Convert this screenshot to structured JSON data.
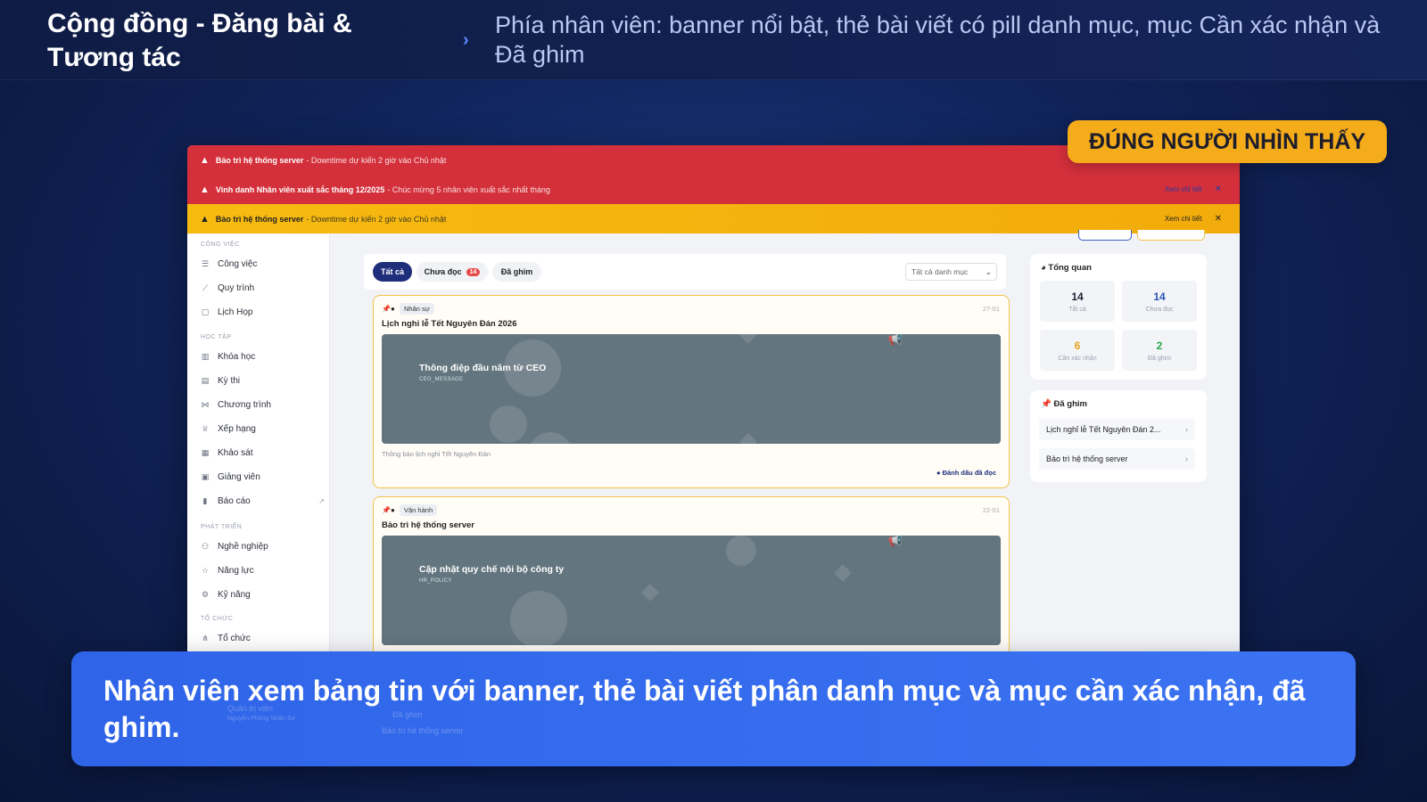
{
  "header": {
    "title": "Cộng đồng - Đăng bài & Tương tác",
    "subtitle": "Phía nhân viên: banner nổi bật, thẻ bài viết có pill danh mục, mục Cần xác nhận và Đã ghim"
  },
  "badge": "ĐÚNG NGƯỜI NHÌN THẤY",
  "banners": [
    {
      "title": "Bảo trì hệ thống server",
      "desc": "- Downtime dự kiến 2 giờ vào Chủ nhật",
      "link": "",
      "color": "#d4303b"
    },
    {
      "title": "Vinh danh Nhân viên xuất sắc tháng 12/2025",
      "desc": "- Chúc mừng 5 nhân viên xuất sắc nhất tháng",
      "link": "Xem chi tiết",
      "color": "#d4303b"
    },
    {
      "title": "Bảo trì hệ thống server",
      "desc": "- Downtime dự kiến 2 giờ vào Chủ nhật",
      "link": "Xem chi tiết",
      "color": "#f5b50f"
    }
  ],
  "sidebar": {
    "sections": [
      "CÔNG VIỆC",
      "HỌC TẬP",
      "PHÁT TRIỂN",
      "TỔ CHỨC"
    ],
    "items": [
      {
        "label": "Công việc",
        "icon": "list-icon"
      },
      {
        "label": "Quy trình",
        "icon": "flow-icon"
      },
      {
        "label": "Lịch Họp",
        "icon": "calendar-icon"
      },
      {
        "label": "Khóa học",
        "icon": "book-icon"
      },
      {
        "label": "Kỳ thi",
        "icon": "exam-icon"
      },
      {
        "label": "Chương trình",
        "icon": "program-icon"
      },
      {
        "label": "Xếp hạng",
        "icon": "trophy-icon"
      },
      {
        "label": "Khảo sát",
        "icon": "survey-icon"
      },
      {
        "label": "Giảng viên",
        "icon": "teacher-icon"
      },
      {
        "label": "Báo cáo",
        "icon": "chart-icon"
      },
      {
        "label": "Nghề nghiệp",
        "icon": "career-icon"
      },
      {
        "label": "Năng lực",
        "icon": "star-icon"
      },
      {
        "label": "Kỹ năng",
        "icon": "skill-icon"
      },
      {
        "label": "Tổ chức",
        "icon": "org-icon"
      }
    ]
  },
  "tabs": {
    "all": "Tất cả",
    "unread": "Chưa đọc",
    "unread_count": "14",
    "pinned": "Đã ghim",
    "category_select": "Tất cả danh mục"
  },
  "posts": [
    {
      "category": "Nhân sự",
      "date": "27-01",
      "title": "Lịch nghỉ lễ Tết Nguyên Đán 2026",
      "media_title": "Thông điệp đầu năm từ CEO",
      "media_code": "CEO_MESSAGE",
      "desc": "Thông báo lịch nghỉ Tết Nguyên Đán",
      "action": "Đánh dấu đã đọc"
    },
    {
      "category": "Vận hành",
      "date": "22-01",
      "title": "Bảo trì hệ thống server",
      "media_title": "Cập nhật quy chế nội bộ công ty",
      "media_code": "HR_POLICY"
    }
  ],
  "overview": {
    "title": "Tổng quan",
    "stats": [
      {
        "value": "14",
        "label": "Tất cả",
        "color": "#1d2233"
      },
      {
        "value": "14",
        "label": "Chưa đọc",
        "color": "#2b54b8"
      },
      {
        "value": "6",
        "label": "Cần xác nhận",
        "color": "#e7a21b"
      },
      {
        "value": "2",
        "label": "Đã ghim",
        "color": "#2aa84a"
      }
    ]
  },
  "pinned_panel": {
    "title": "Đã ghim",
    "items": [
      "Lịch nghỉ lễ Tết Nguyên Đán 2...",
      "Bảo trì hệ thống server"
    ]
  },
  "caption": "Nhân viên xem bảng tin với banner, thẻ bài viết phân danh mục và mục cần xác nhận, đã ghim.",
  "ghost_text": {
    "admin": "Quản trị viên",
    "admin_sub": "Nguyễn Phòng Nhân Sự",
    "pinned": "Đã ghim",
    "post_title": "Bảo trì hệ thống server"
  }
}
